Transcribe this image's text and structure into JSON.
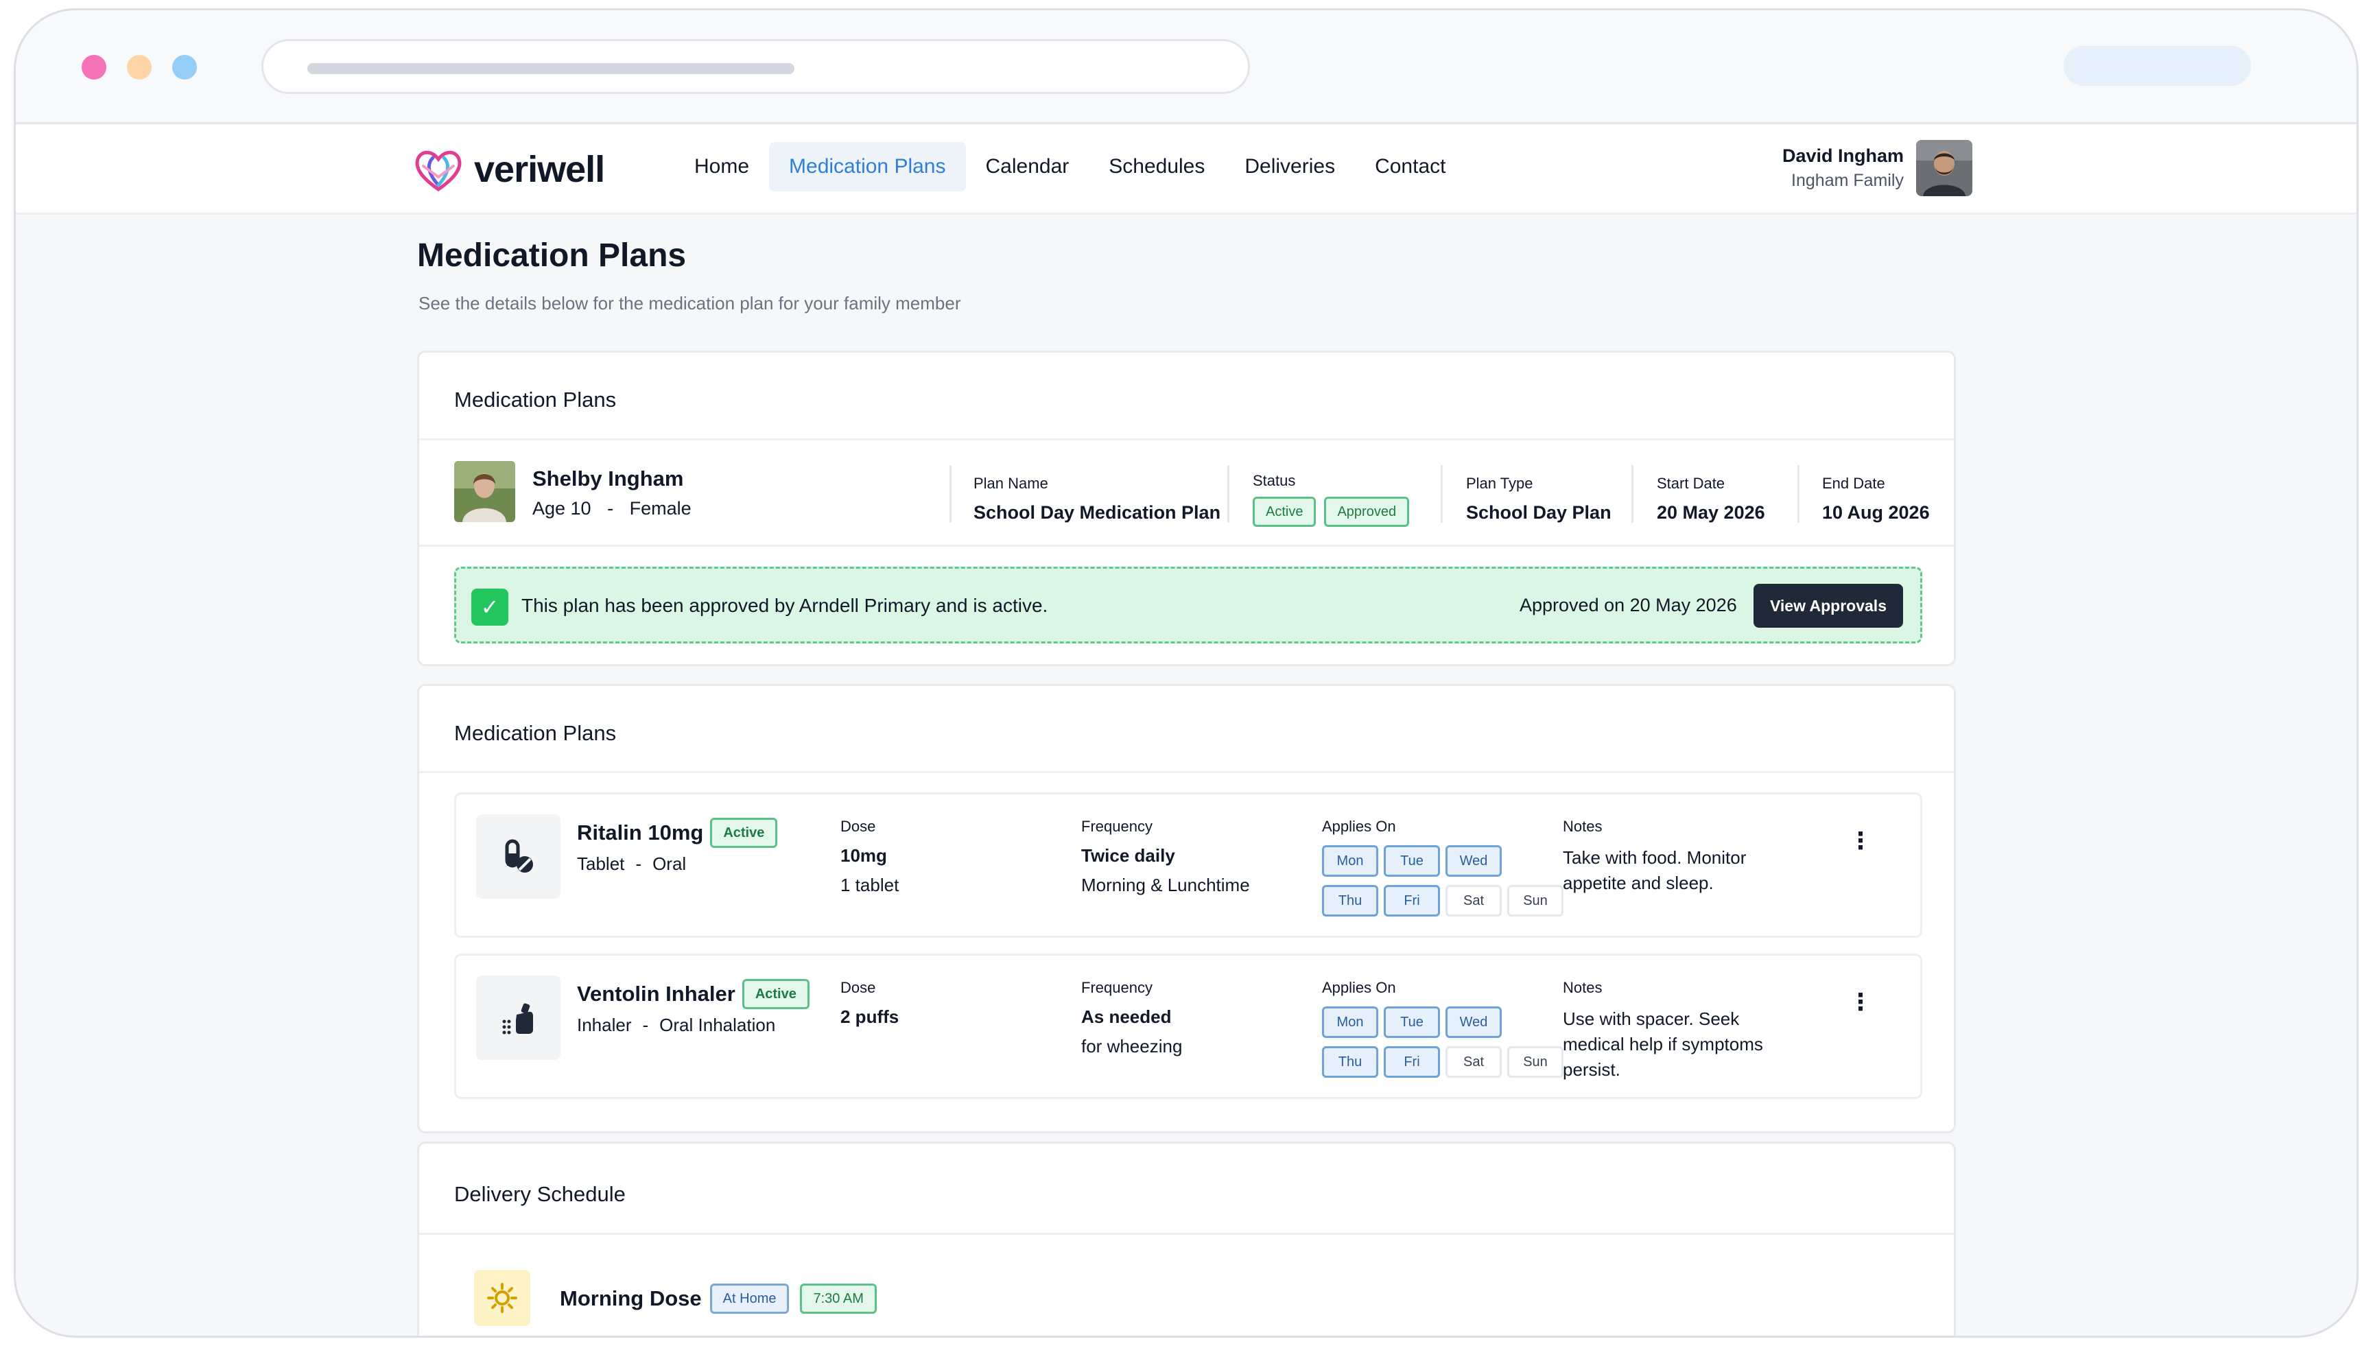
{
  "brand": {
    "name": "veriwell",
    "accent": "#2f7fd6"
  },
  "nav": {
    "items": [
      "Home",
      "Medication Plans",
      "Calendar",
      "Schedules",
      "Deliveries",
      "Contact"
    ],
    "active": "Medication Plans"
  },
  "user": {
    "name": "David Ingham",
    "family": "Ingham Family"
  },
  "page": {
    "title": "Medication Plans",
    "subtitle": "See the details below for the medication plan for your family member"
  },
  "plan_card": {
    "title": "Medication Plans",
    "patient": {
      "name": "Shelby Ingham",
      "age": "Age 10",
      "sep": "-",
      "gender": "Female"
    },
    "plan_name_label": "Plan Name",
    "plan_name": "School Day Medication Plan",
    "status_label": "Status",
    "status_badges": [
      "Active",
      "Approved"
    ],
    "plan_type_label": "Plan Type",
    "plan_type": "School Day Plan",
    "start_label": "Start Date",
    "start_date": "20 May 2026",
    "end_label": "End Date",
    "end_date": "10 Aug 2026",
    "approval": {
      "message": "This plan has been approved by Arndell Primary and is active.",
      "date": "Approved on 20 May 2026",
      "button": "View Approvals",
      "check": "✓"
    }
  },
  "meds_card": {
    "title": "Medication Plans",
    "items": [
      {
        "name": "Ritalin 10mg",
        "badge": "Active",
        "form": "Tablet",
        "sep": "-",
        "route": "Oral",
        "dose_label": "Dose",
        "dose1": "10mg",
        "dose2": "1 tablet",
        "freq_label": "Frequency",
        "freq1": "Twice daily",
        "freq2": "Morning & Lunchtime",
        "applies_label": "Applies On",
        "days": [
          "Mon",
          "Tue",
          "Wed",
          "Thu",
          "Fri",
          "Sat",
          "Sun"
        ],
        "days_on": [
          "Mon",
          "Tue",
          "Wed",
          "Thu",
          "Fri"
        ],
        "notes_label": "Notes",
        "notes1": "Take with food. Monitor",
        "notes2": "appetite and sleep.",
        "notes3": "",
        "icon": "pill-icon"
      },
      {
        "name": "Ventolin Inhaler",
        "badge": "Active",
        "form": "Inhaler",
        "sep": "-",
        "route": "Oral Inhalation",
        "dose_label": "Dose",
        "dose1": "2 puffs",
        "dose2": "",
        "freq_label": "Frequency",
        "freq1": "As needed",
        "freq2": "for wheezing",
        "applies_label": "Applies On",
        "days": [
          "Mon",
          "Tue",
          "Wed",
          "Thu",
          "Fri",
          "Sat",
          "Sun"
        ],
        "days_on": [
          "Mon",
          "Tue",
          "Wed",
          "Thu",
          "Fri"
        ],
        "notes_label": "Notes",
        "notes1": "Use with spacer. Seek",
        "notes2": "medical help if symptoms",
        "notes3": "persist.",
        "icon": "inhaler-icon"
      }
    ],
    "more": "⋮"
  },
  "delivery_card": {
    "title": "Delivery Schedule",
    "dose": {
      "name": "Morning Dose",
      "location": "At Home",
      "time": "7:30 AM",
      "icon": "sun-icon"
    }
  }
}
